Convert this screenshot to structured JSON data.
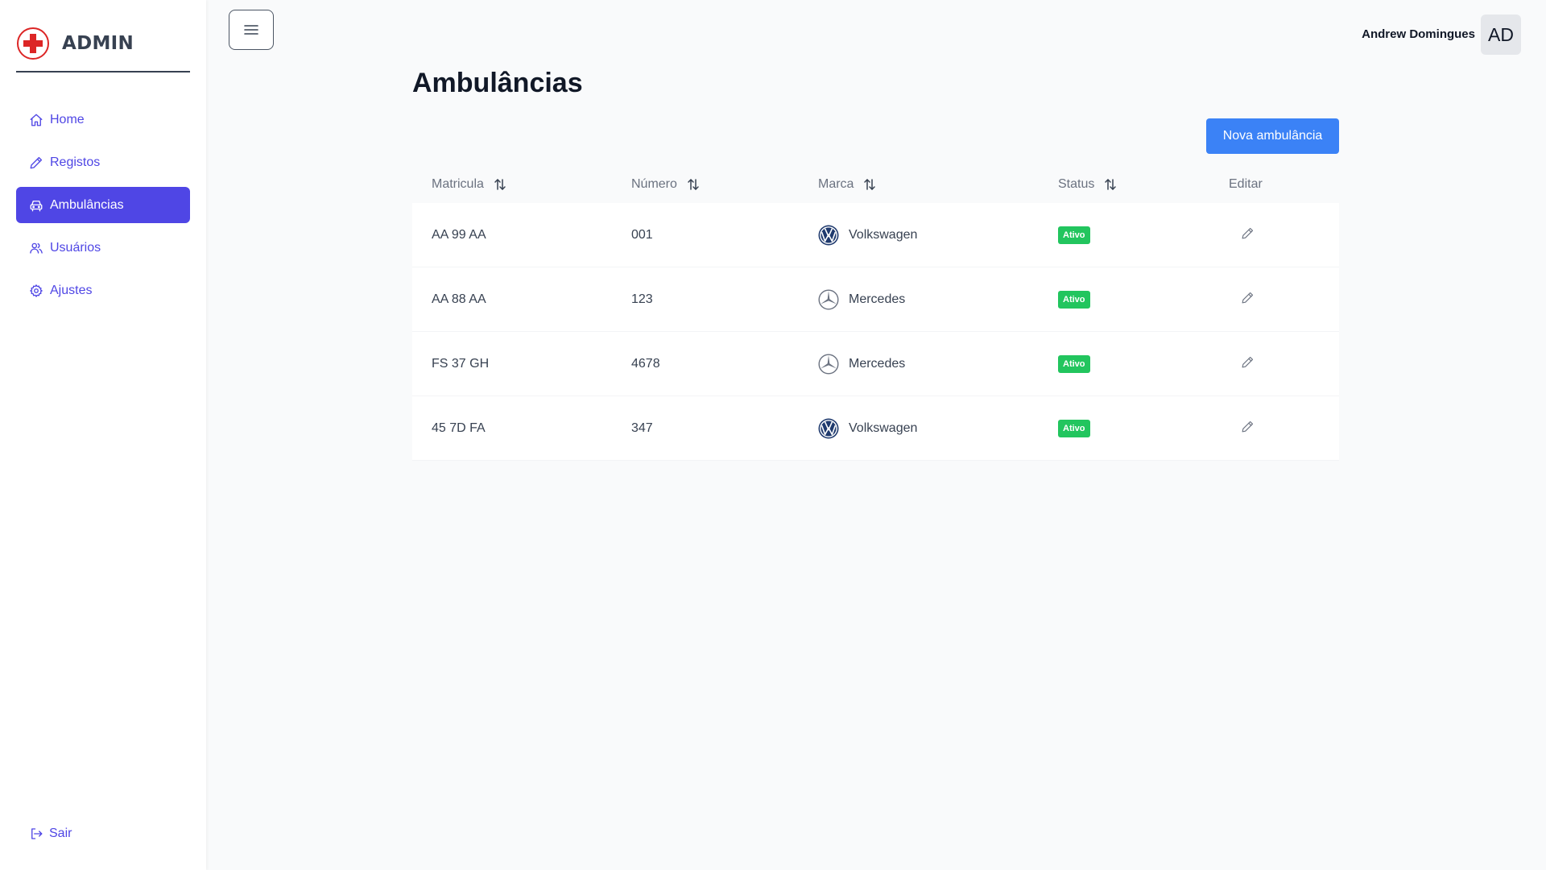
{
  "brand": {
    "title": "ADMIN",
    "logo": "red-cross-icon",
    "accent": "#dc2626"
  },
  "sidebar": {
    "items": [
      {
        "label": "Home",
        "icon": "home-icon",
        "active": false
      },
      {
        "label": "Registos",
        "icon": "pencil-icon",
        "active": false
      },
      {
        "label": "Ambulâncias",
        "icon": "car-icon",
        "active": true
      },
      {
        "label": "Usuários",
        "icon": "users-icon",
        "active": false
      },
      {
        "label": "Ajustes",
        "icon": "gear-icon",
        "active": false
      }
    ],
    "logout_label": "Sair",
    "accent": "#4f46e5"
  },
  "header": {
    "menu_icon": "hamburger-menu-icon",
    "user_name": "Andrew Domingues",
    "avatar_initials": "AD"
  },
  "main": {
    "title": "Ambulâncias",
    "new_button_label": "Nova ambulância",
    "button_color": "#3b82f6"
  },
  "table": {
    "columns": [
      {
        "label": "Matricula",
        "sortable": true
      },
      {
        "label": "Número",
        "sortable": true
      },
      {
        "label": "Marca",
        "sortable": true
      },
      {
        "label": "Status",
        "sortable": true
      },
      {
        "label": "Editar",
        "sortable": false
      }
    ],
    "rows": [
      {
        "plate": "AA 99 AA",
        "number": "001",
        "brand": "Volkswagen",
        "brand_icon": "volkswagen-logo-icon",
        "status": "Ativo"
      },
      {
        "plate": "AA 88 AA",
        "number": "123",
        "brand": "Mercedes",
        "brand_icon": "mercedes-logo-icon",
        "status": "Ativo"
      },
      {
        "plate": "FS 37 GH",
        "number": "4678",
        "brand": "Mercedes",
        "brand_icon": "mercedes-logo-icon",
        "status": "Ativo"
      },
      {
        "plate": "45 7D FA",
        "number": "347",
        "brand": "Volkswagen",
        "brand_icon": "volkswagen-logo-icon",
        "status": "Ativo"
      }
    ],
    "status_color": "#22c55e"
  }
}
